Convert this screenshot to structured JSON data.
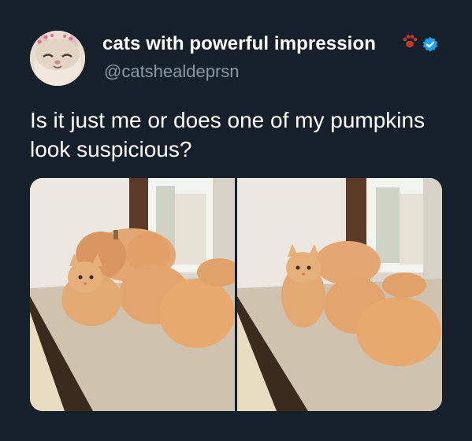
{
  "tweet": {
    "display_name": "cats with powerful impression",
    "handle": "@catshealdeprsn",
    "text": "Is it just me or does one of my pumpkins look suspicious?",
    "icons": [
      "paw-icon",
      "verified-icon"
    ],
    "colors": {
      "background": "#15202b",
      "handle": "#8899a6",
      "verified": "#1da1f2",
      "paw": "#c0392b"
    }
  },
  "media": {
    "photos": [
      {
        "subject": "cat-among-pumpkins-1"
      },
      {
        "subject": "cat-among-pumpkins-2"
      }
    ]
  }
}
